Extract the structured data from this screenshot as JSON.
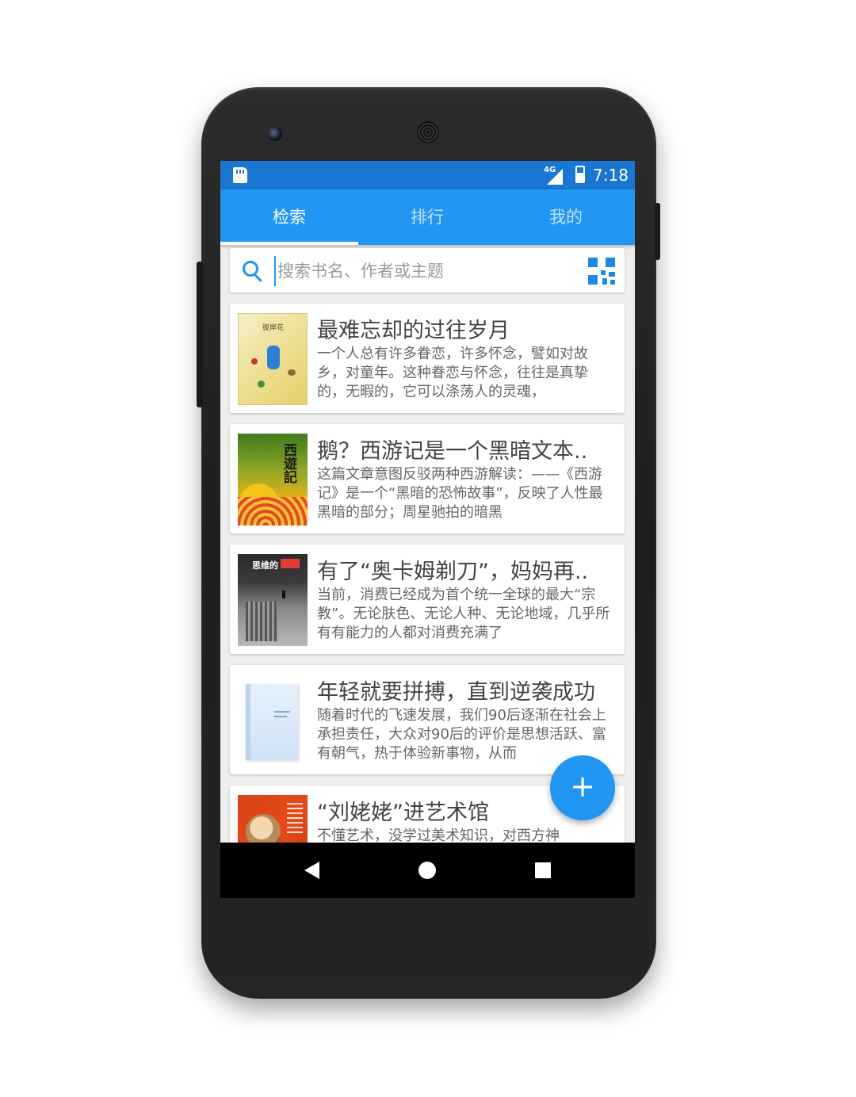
{
  "status_bar": {
    "network": "4G",
    "time": "7:18",
    "icons": [
      "sd-card-icon",
      "signal-icon",
      "battery-icon"
    ]
  },
  "tabs": [
    {
      "label": "检索",
      "active": true
    },
    {
      "label": "排行",
      "active": false
    },
    {
      "label": "我的",
      "active": false
    }
  ],
  "search": {
    "placeholder": "搜索书名、作者或主题",
    "value": ""
  },
  "books": [
    {
      "title": "最难忘却的过往岁月",
      "desc": "一个人总有许多眷恋，许多怀念，譬如对故乡，对童年。这种眷恋与怀念，往往是真挚的，无暇的，它可以涤荡人的灵魂，",
      "cover_text": "彼岸花"
    },
    {
      "title": "鹅？西游记是一个黑暗文本..",
      "desc": "这篇文章意图反驳两种西游解读：——《西游记》是一个“黑暗的恐怖故事”，反映了人性最黑暗的部分；周星驰拍的暗黑",
      "cover_text": "西遊記"
    },
    {
      "title": "有了“奥卡姆剃刀”，妈妈再..",
      "desc": "当前，消费已经成为首个统一全球的最大“宗教”。无论肤色、无论人种、无论地域，几乎所有有能力的人都对消费充满了",
      "cover_text": "思维的"
    },
    {
      "title": "年轻就要拼搏，直到逆袭成功",
      "desc": "随着时代的飞速发展，我们90后逐渐在社会上承担责任，大众对90后的评价是思想活跃、富有朝气，热于体验新事物，从而",
      "cover_text": ""
    },
    {
      "title": "“刘姥姥”进艺术馆",
      "desc": "不懂艺术，没学过美术知识，对西方神",
      "cover_text": ""
    }
  ],
  "fab": {
    "label": "+"
  },
  "colors": {
    "primary": "#2196f3",
    "primary_dark": "#1976d2",
    "background": "#eeeeee"
  }
}
